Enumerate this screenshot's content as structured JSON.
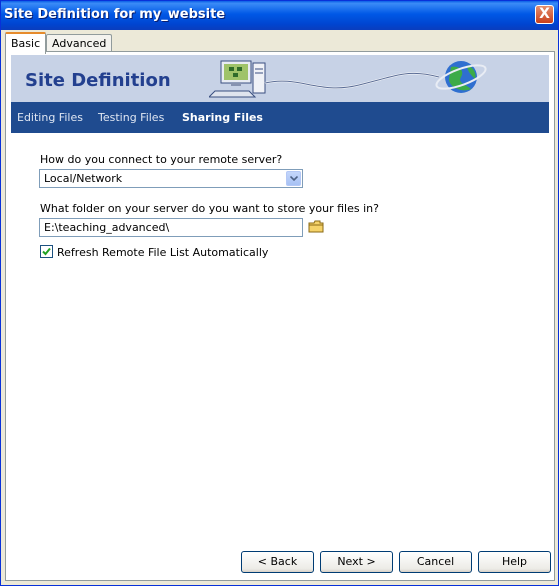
{
  "window": {
    "title": "Site Definition for my_website",
    "close_label": "X"
  },
  "tabs": [
    {
      "label": "Basic"
    },
    {
      "label": "Advanced"
    }
  ],
  "banner": {
    "title": "Site Definition"
  },
  "steps": [
    {
      "label": "Editing Files"
    },
    {
      "label": "Testing Files"
    },
    {
      "label": "Sharing Files"
    }
  ],
  "form": {
    "connect_question": "How do you connect to your remote server?",
    "connect_value": "Local/Network",
    "folder_question": "What folder on your server do you want to store your files in?",
    "folder_value": "E:\\teaching_advanced\\",
    "refresh_label": "Refresh Remote File List Automatically",
    "refresh_checked": true
  },
  "buttons": {
    "back": "< Back",
    "next": "Next >",
    "cancel": "Cancel",
    "help": "Help"
  }
}
